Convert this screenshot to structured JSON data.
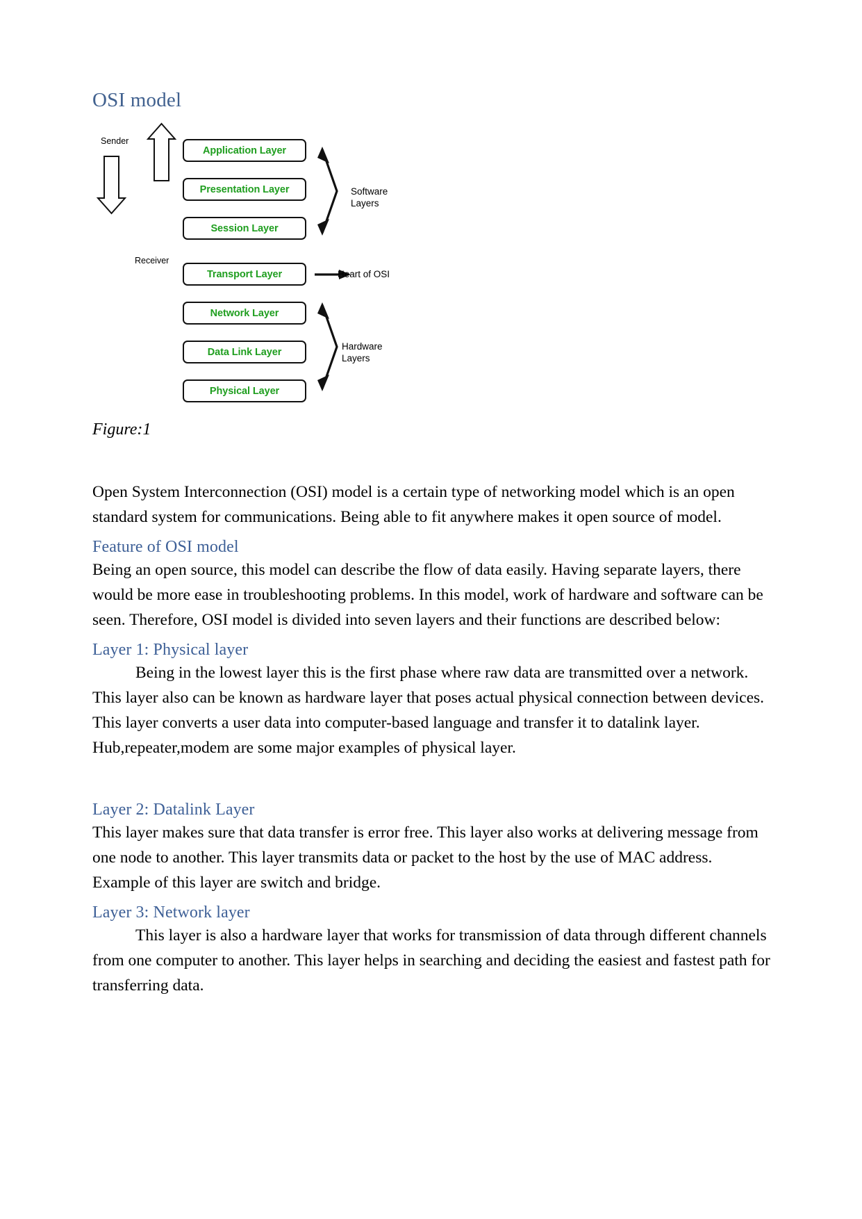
{
  "document": {
    "title": "OSI model",
    "figure": {
      "caption": "Figure:1",
      "layers": [
        {
          "name": "Application Layer"
        },
        {
          "name": "Presentation Layer"
        },
        {
          "name": "Session Layer"
        },
        {
          "name": "Transport Layer"
        },
        {
          "name": "Network Layer"
        },
        {
          "name": "Data Link Layer"
        },
        {
          "name": "Physical Layer"
        }
      ],
      "annotations": {
        "sender": "Sender",
        "receiver": "Receiver",
        "software_layers": "Software\nLayers",
        "heart_of_osi": "Heart of OSI",
        "hardware_layers": "Hardware\nLayers"
      },
      "colors": {
        "layer_text": "#1f9e1f",
        "box_border": "#111111",
        "annotation_text": "#000000"
      }
    },
    "sections": [
      {
        "heading": null,
        "paragraphs": [
          " Open System Interconnection (OSI) model is a certain type of networking model which is an open standard system for communications. Being able to fit anywhere makes it open source of model."
        ]
      },
      {
        "heading": "Feature of OSI model",
        "paragraphs": [
          "Being an open source, this model can describe the flow of data easily. Having separate layers, there would be more ease in troubleshooting problems. In this model, work of hardware and software can be seen. Therefore, OSI model is divided into seven layers and their functions are described below:"
        ]
      },
      {
        "heading": "Layer 1: Physical layer",
        "indent_first": true,
        "paragraphs": [
          "Being in the lowest layer this is the first phase where raw data are transmitted   over a network. This layer also can be known as hardware layer that poses actual physical connection between devices. This layer converts a user data into computer-based language and transfer it to datalink layer. Hub,repeater,modem are some major examples of physical layer."
        ]
      },
      {
        "heading": "Layer 2: Datalink Layer",
        "indent_first": false,
        "paragraphs": [
          "This layer makes sure that data transfer is error free. This layer also works at delivering message from one node to another. This layer transmits data or packet to the host by the use of MAC address. Example of this layer are switch and bridge."
        ]
      },
      {
        "heading": "Layer 3: Network layer",
        "indent_first": true,
        "paragraphs": [
          "This layer is also a hardware layer that works for transmission of data through different channels from one computer to another. This layer helps in searching and deciding the easiest and fastest path for transferring data."
        ]
      }
    ],
    "colors": {
      "heading": "#3e6097",
      "title": "#41618f",
      "body": "#000000",
      "background": "#ffffff"
    }
  }
}
